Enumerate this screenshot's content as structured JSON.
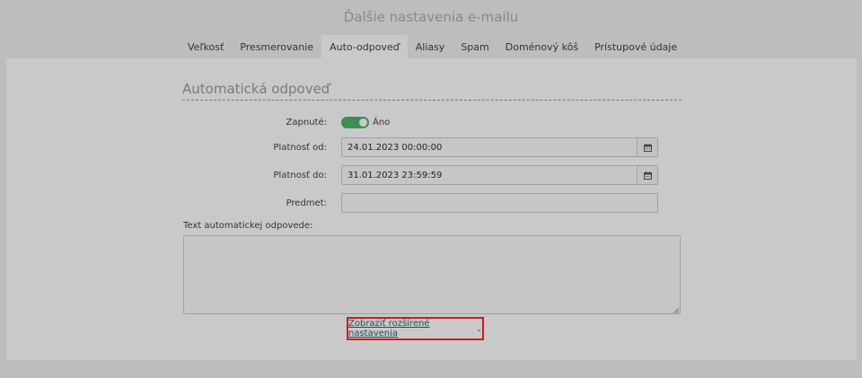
{
  "header": {
    "title": "Ďalšie nastavenia e-mailu"
  },
  "tabs": [
    {
      "label": "Veľkosť",
      "active": false
    },
    {
      "label": "Presmerovanie",
      "active": false
    },
    {
      "label": "Auto-odpoveď",
      "active": true
    },
    {
      "label": "Aliasy",
      "active": false
    },
    {
      "label": "Spam",
      "active": false
    },
    {
      "label": "Doménový kôš",
      "active": false
    },
    {
      "label": "Prístupové údaje",
      "active": false
    }
  ],
  "section": {
    "title": "Automatická odpoveď"
  },
  "form": {
    "enabled": {
      "label": "Zapnuté:",
      "value_text": "Áno",
      "on": true
    },
    "valid_from": {
      "label": "Platnosť od:",
      "value": "24.01.2023 00:00:00"
    },
    "valid_to": {
      "label": "Platnosť do:",
      "value": "31.01.2023 23:59:59"
    },
    "subject": {
      "label": "Predmet:",
      "value": ""
    },
    "body": {
      "label": "Text automatickej odpovede:",
      "value": ""
    }
  },
  "advanced_link": {
    "label": "Zobraziť rozšírené nastavenia",
    "icon": "chevron-down-icon"
  },
  "colors": {
    "toggle_on": "#3d8e53",
    "highlight_border": "#d9161c",
    "link": "#1f4e5f"
  }
}
